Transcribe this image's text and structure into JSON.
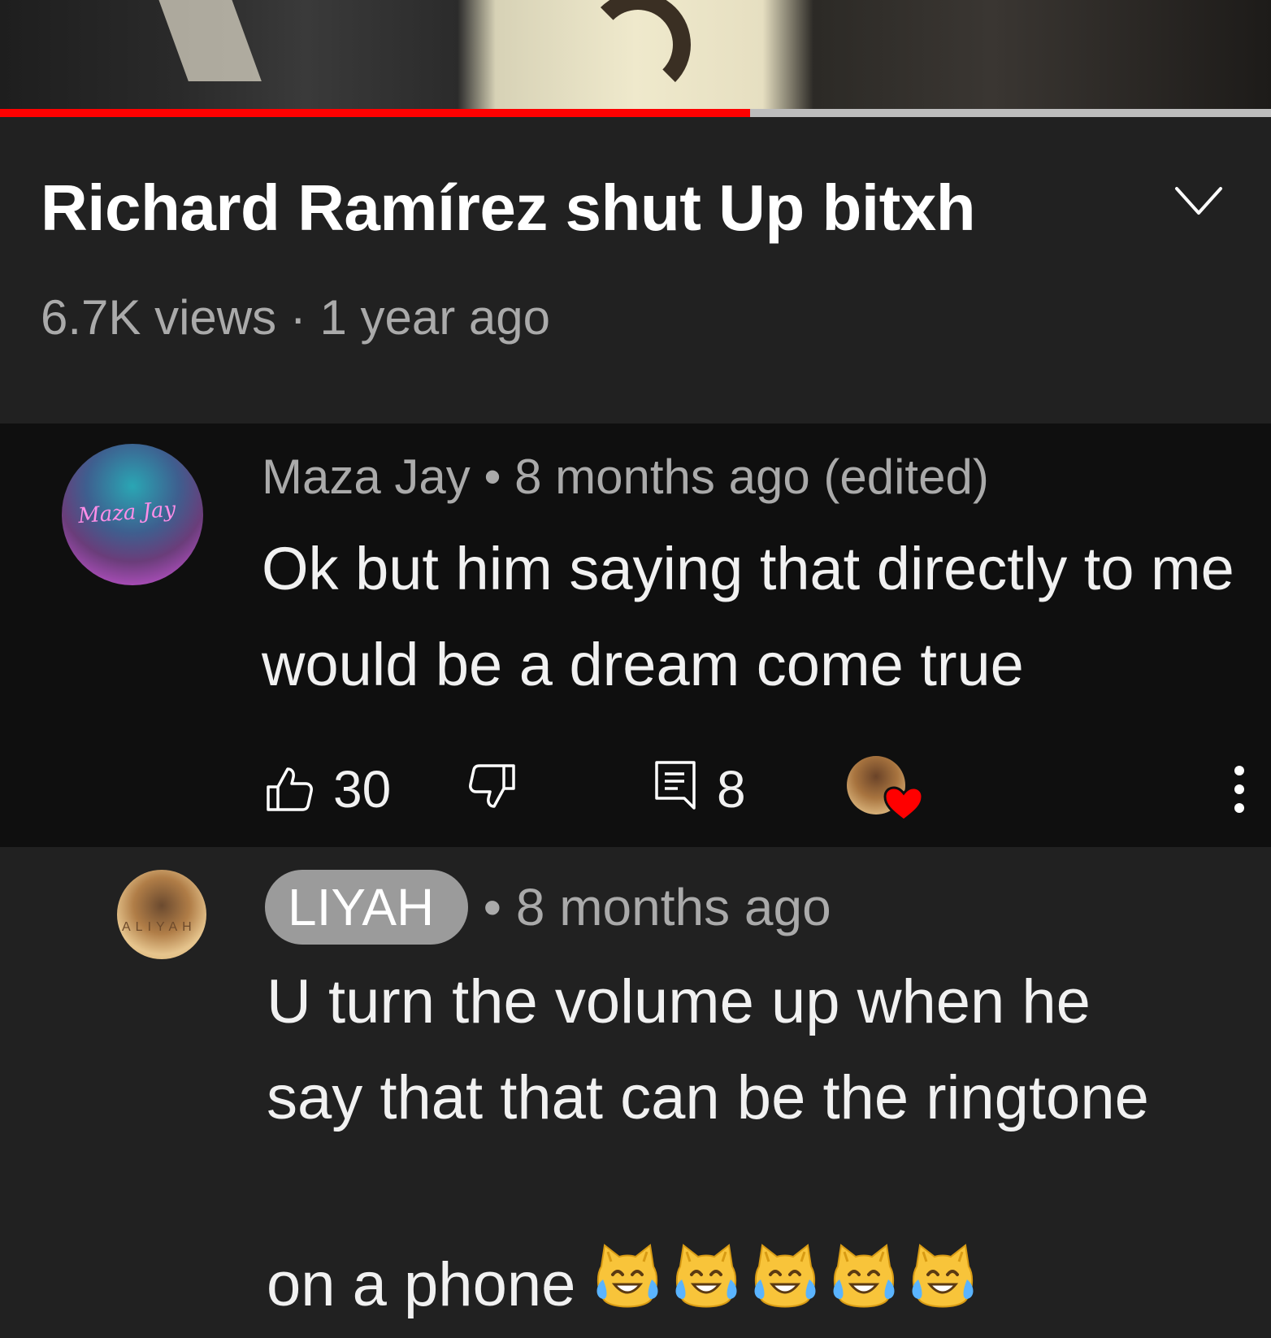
{
  "video": {
    "title": "Richard Ramírez shut Up bitxh",
    "meta": "6.7K views · 1 year ago",
    "progress_fraction": 0.59,
    "progress_color": "#ff0000"
  },
  "comment": {
    "author": "Maza Jay",
    "avatar_text": "Maza Jay",
    "time": "8 months ago (edited)",
    "text": "Ok but him saying that directly to me would be a dream come true",
    "likes": "30",
    "replies": "8"
  },
  "reply": {
    "author": "LIYAH",
    "avatar_text": "ALIYAH",
    "time": "8 months ago",
    "text": "U turn the volume up when he\nsay that   that can be the ringtone\non a phone",
    "emoji": [
      "cat-tears-of-joy",
      "cat-tears-of-joy",
      "cat-tears-of-joy",
      "cat-tears-of-joy",
      "cat-tears-of-joy"
    ]
  },
  "icons": {
    "collapse": "chevron-down-icon",
    "like": "thumbs-up-icon",
    "dislike": "thumbs-down-icon",
    "reply": "comment-icon",
    "heart": "heart-icon",
    "more": "more-vertical-icon"
  },
  "colors": {
    "background": "#212121",
    "comment_bg": "#0f0f0f",
    "secondary_text": "#aaaaaa",
    "chip": "#9b9b9b",
    "heart": "#ff0000"
  }
}
